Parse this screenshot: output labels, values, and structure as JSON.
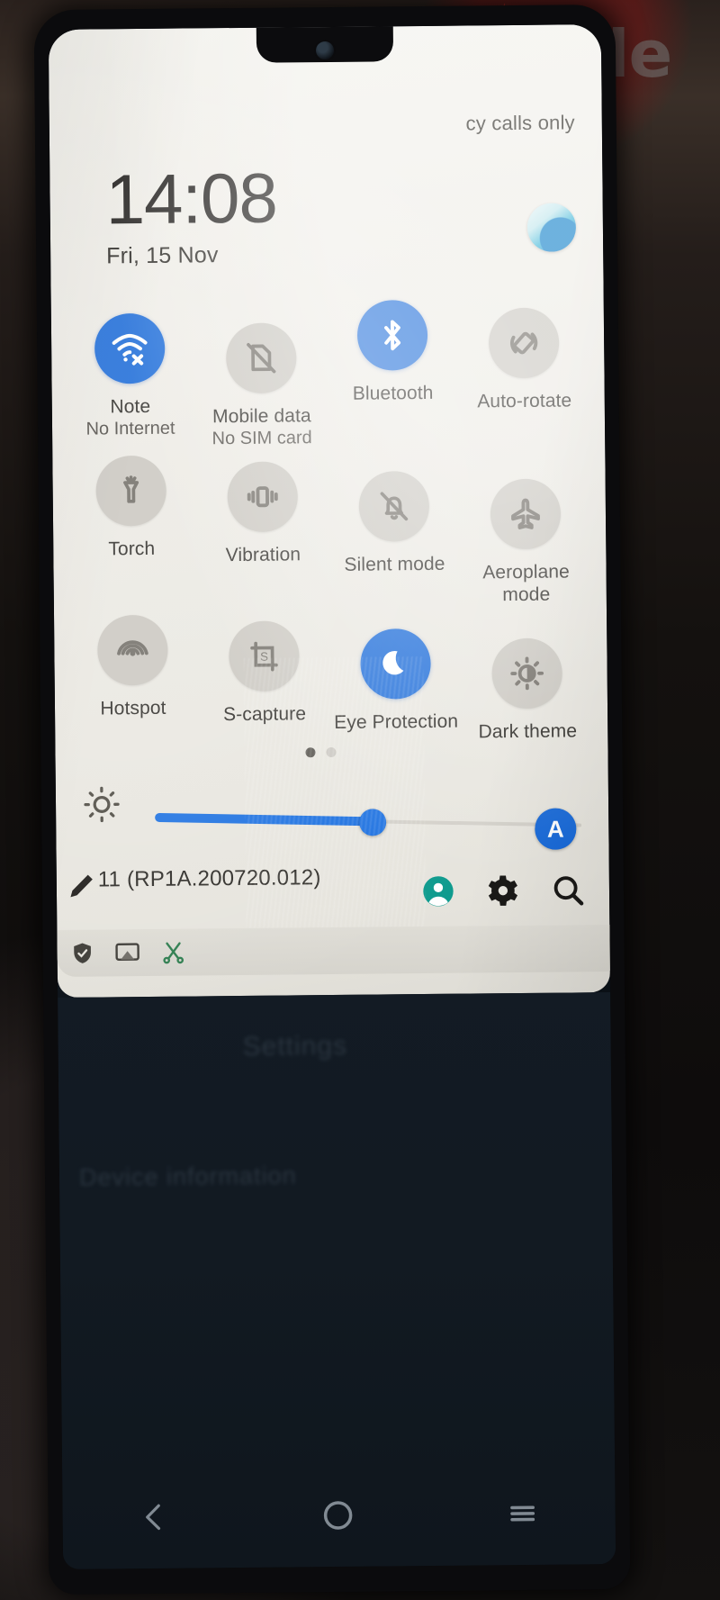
{
  "watermark": {
    "text": "dubizzle",
    "flame_icon": "flame-icon"
  },
  "statusbar": {
    "carrier_text": "cy calls only"
  },
  "lockclock": {
    "time": "14:08",
    "date": "Fri, 15 Nov"
  },
  "colors": {
    "accent": "#1668d8",
    "tile_off": "#c9c6bf",
    "shade_bg": "#eeece6",
    "text": "#2a2824"
  },
  "tiles": {
    "rows": [
      [
        {
          "label": "Note",
          "sub": "No Internet",
          "state": "on",
          "icon": "wifi-no-internet-icon",
          "badge": "triangle-alert-icon"
        },
        {
          "label": "Mobile data",
          "sub": "No SIM card",
          "state": "off",
          "icon": "sim-card-off-icon",
          "badge": ""
        },
        {
          "label": "Bluetooth",
          "sub": "",
          "state": "on",
          "icon": "bluetooth-icon",
          "badge": ""
        },
        {
          "label": "Auto-rotate",
          "sub": "",
          "state": "off",
          "icon": "auto-rotate-icon",
          "badge": ""
        }
      ],
      [
        {
          "label": "Torch",
          "sub": "",
          "state": "off",
          "icon": "flashlight-icon",
          "badge": ""
        },
        {
          "label": "Vibration",
          "sub": "",
          "state": "off",
          "icon": "vibration-icon",
          "badge": ""
        },
        {
          "label": "Silent mode",
          "sub": "",
          "state": "off",
          "icon": "bell-off-icon",
          "badge": ""
        },
        {
          "label": "Aeroplane mode",
          "sub": "",
          "state": "off",
          "icon": "airplane-icon",
          "badge": ""
        }
      ],
      [
        {
          "label": "Hotspot",
          "sub": "",
          "state": "off",
          "icon": "hotspot-icon",
          "badge": ""
        },
        {
          "label": "S-capture",
          "sub": "",
          "state": "off",
          "icon": "screenshot-capture-icon",
          "badge": ""
        },
        {
          "label": "Eye Protection",
          "sub": "",
          "state": "on",
          "icon": "moon-icon",
          "badge": ""
        },
        {
          "label": "Dark theme",
          "sub": "",
          "state": "off",
          "icon": "contrast-brightness-icon",
          "badge": ""
        }
      ]
    ]
  },
  "pager": {
    "pages": 2,
    "active_index": 0
  },
  "brightness": {
    "icon": "brightness-sun-icon",
    "value_percent": 51,
    "auto_label": "A"
  },
  "footer": {
    "edit_icon": "pencil-edit-icon",
    "build_text": "11 (RP1A.200720.012)",
    "icons": [
      {
        "name": "user-account-icon"
      },
      {
        "name": "settings-gear-icon"
      },
      {
        "name": "search-icon"
      }
    ]
  },
  "notification_strip": {
    "icons": [
      {
        "name": "shield-security-icon"
      },
      {
        "name": "screen-cast-icon"
      },
      {
        "name": "scissors-icon"
      }
    ]
  },
  "background_ghost_text": {
    "line1": "Settings",
    "line2": "Device information"
  },
  "navbar": {
    "back": "back-chevron-icon",
    "home": "home-circle-icon",
    "recents": "recents-menu-icon"
  }
}
